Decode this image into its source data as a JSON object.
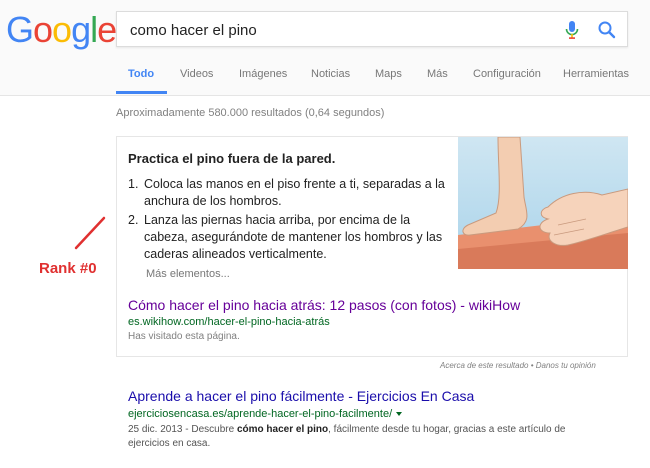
{
  "logo": {
    "letters": [
      "G",
      "o",
      "o",
      "g",
      "l",
      "e"
    ],
    "colors": [
      "#4285f4",
      "#ea4335",
      "#fbbc05",
      "#4285f4",
      "#34a853",
      "#ea4335"
    ]
  },
  "search": {
    "query": "como hacer el pino"
  },
  "tabs": [
    {
      "label": "Todo",
      "active": true
    },
    {
      "label": "Videos"
    },
    {
      "label": "Imágenes"
    },
    {
      "label": "Noticias"
    },
    {
      "label": "Maps"
    },
    {
      "label": "Más"
    },
    {
      "label": "Configuración"
    },
    {
      "label": "Herramientas"
    }
  ],
  "result_stats": "Aproximadamente 580.000 resultados (0,64 segundos)",
  "snippet": {
    "title": "Practica el pino fuera de la pared.",
    "steps": [
      {
        "num": "1.",
        "text": "Coloca las manos en el piso frente a ti, separadas a la anchura de los hombros."
      },
      {
        "num": "2.",
        "text": "Lanza las piernas hacia arriba, por encima de la cabeza, asegurándote de mantener los hombros y las caderas alineados verticalmente."
      }
    ],
    "more": "Más elementos...",
    "link": "Cómo hacer el pino hacia atrás: 12 pasos (con fotos) - wikiHow",
    "url": "es.wikihow.com/hacer-el-pino-hacia-atrás",
    "visited": "Has visitado esta página.",
    "feedback": "Acerca de este resultado • Danos tu opinión"
  },
  "annotation": {
    "label": "Rank #0",
    "color": "#e03030"
  },
  "result2": {
    "title": "Aprende a hacer el pino fácilmente - Ejercicios En Casa",
    "url": "ejerciciosencasa.es/aprende-hacer-el-pino-facilmente/",
    "date": "25 dic. 2013",
    "snippet_pre": " - Descubre ",
    "snippet_bold": "cómo hacer el pino",
    "snippet_post": ", fácilmente desde tu hogar, gracias a este artículo de ejercicios en casa."
  }
}
